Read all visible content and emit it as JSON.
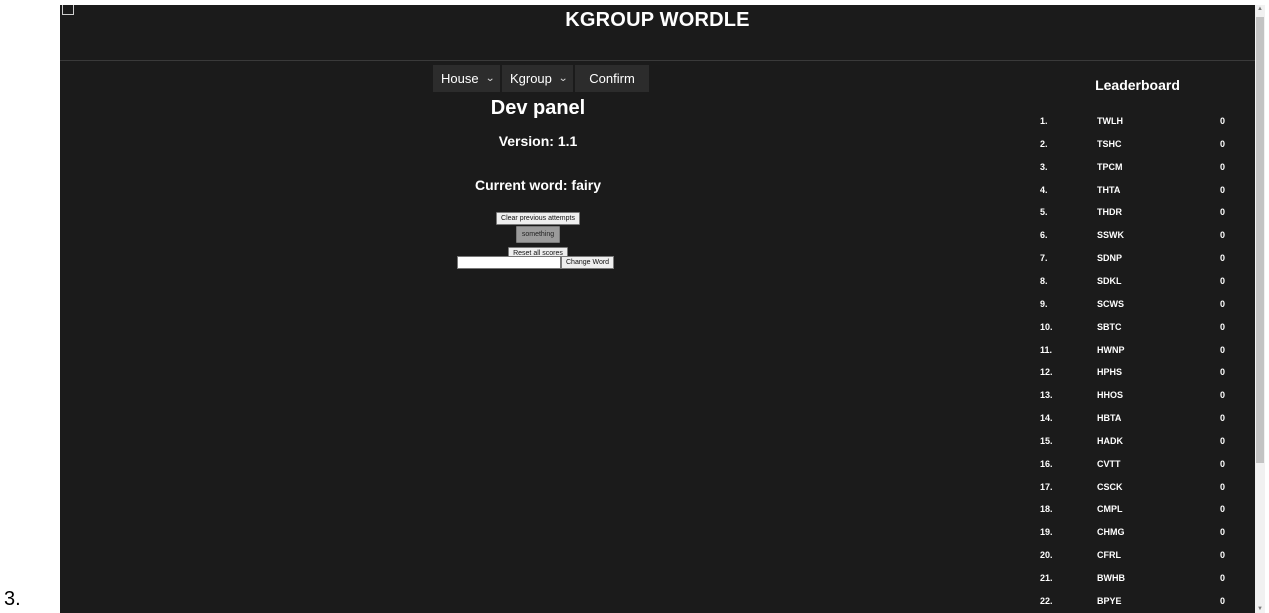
{
  "doc_label": "3.",
  "app": {
    "title": "KGROUP WORDLE"
  },
  "controls": {
    "house_select": "House",
    "kgroup_select": "Kgroup",
    "confirm_label": "Confirm"
  },
  "dev_panel": {
    "title": "Dev panel",
    "version": "Version: 1.1",
    "current_word": "Current word: fairy",
    "clear_label": "Clear previous attempts",
    "something_label": "something",
    "reset_label": "Reset all scores",
    "word_input_value": "",
    "change_word_label": "Change Word"
  },
  "leaderboard": {
    "title": "Leaderboard",
    "rows": [
      {
        "rank": "1.",
        "name": "TWLH",
        "score": "0"
      },
      {
        "rank": "2.",
        "name": "TSHC",
        "score": "0"
      },
      {
        "rank": "3.",
        "name": "TPCM",
        "score": "0"
      },
      {
        "rank": "4.",
        "name": "THTA",
        "score": "0"
      },
      {
        "rank": "5.",
        "name": "THDR",
        "score": "0"
      },
      {
        "rank": "6.",
        "name": "SSWK",
        "score": "0"
      },
      {
        "rank": "7.",
        "name": "SDNP",
        "score": "0"
      },
      {
        "rank": "8.",
        "name": "SDKL",
        "score": "0"
      },
      {
        "rank": "9.",
        "name": "SCWS",
        "score": "0"
      },
      {
        "rank": "10.",
        "name": "SBTC",
        "score": "0"
      },
      {
        "rank": "11.",
        "name": "HWNP",
        "score": "0"
      },
      {
        "rank": "12.",
        "name": "HPHS",
        "score": "0"
      },
      {
        "rank": "13.",
        "name": "HHOS",
        "score": "0"
      },
      {
        "rank": "14.",
        "name": "HBTA",
        "score": "0"
      },
      {
        "rank": "15.",
        "name": "HADK",
        "score": "0"
      },
      {
        "rank": "16.",
        "name": "CVTT",
        "score": "0"
      },
      {
        "rank": "17.",
        "name": "CSCK",
        "score": "0"
      },
      {
        "rank": "18.",
        "name": "CMPL",
        "score": "0"
      },
      {
        "rank": "19.",
        "name": "CHMG",
        "score": "0"
      },
      {
        "rank": "20.",
        "name": "CFRL",
        "score": "0"
      },
      {
        "rank": "21.",
        "name": "BWHB",
        "score": "0"
      },
      {
        "rank": "22.",
        "name": "BPYE",
        "score": "0"
      }
    ]
  },
  "colors": {
    "page_bg": "#1b1b1b",
    "control_bg": "#2c2c2c",
    "text": "#ffffff"
  },
  "icons": {
    "select_chevron": "chevron-down-icon",
    "scroll_up": "scroll-up-icon",
    "scroll_down": "scroll-down-icon"
  }
}
